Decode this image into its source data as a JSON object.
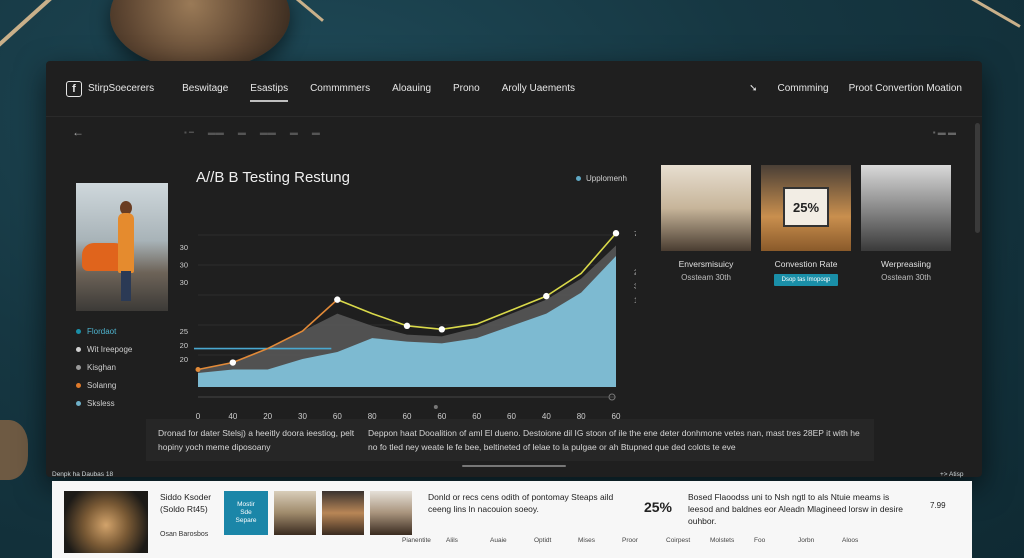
{
  "nav": {
    "brand": "StirpSoecerers",
    "links": [
      "Beswitage",
      "Esastips",
      "Commmmers",
      "Aloauing",
      "Prono",
      "Arolly Uaements"
    ],
    "active_index": 1,
    "right_links": [
      "Commming",
      "Proot Convertion Moation"
    ]
  },
  "left_legend": [
    {
      "label": "Flordaot",
      "color": "#1a8fa8"
    },
    {
      "label": "Wit Ireepoge",
      "color": "#d0d0d0"
    },
    {
      "label": "Kisghan",
      "color": "#cfcfcf"
    },
    {
      "label": "Solanng",
      "color": "#e07a2a"
    },
    {
      "label": "Sksless",
      "color": "#6fb0c8"
    }
  ],
  "chart_data": {
    "type": "line",
    "title": "A//B B Testing Restung",
    "legend": [
      "Upplomenh"
    ],
    "x_tick_labels": [
      "0",
      "40",
      "20",
      "30",
      "60",
      "80",
      "60",
      "60",
      "60",
      "60",
      "40",
      "80",
      "60"
    ],
    "y_tick_labels_left": [
      "30",
      "30",
      "30",
      "25",
      "20",
      "20"
    ],
    "y_tick_labels_right": [
      "7.6%",
      "25%",
      "3.6%",
      "10%"
    ],
    "series": [
      {
        "name": "Upplomenh",
        "type": "line",
        "color": "#d9d94a",
        "values": [
          30,
          34,
          42,
          52,
          70,
          62,
          55,
          53,
          56,
          64,
          72,
          85,
          108
        ]
      },
      {
        "type": "area",
        "color": "#7fc0d8",
        "values": [
          28,
          30,
          30,
          36,
          40,
          48,
          46,
          45,
          48,
          55,
          62,
          74,
          95
        ]
      },
      {
        "type": "area",
        "color": "#5a5a5a",
        "values": [
          30,
          34,
          42,
          52,
          62,
          55,
          50,
          49,
          54,
          62,
          70,
          82,
          101
        ]
      }
    ],
    "reference_line": 42,
    "ylim": [
      20,
      115
    ]
  },
  "cards": [
    {
      "title": "Enversmisuicy",
      "sub": "Ossteam 30th"
    },
    {
      "title": "Convestion Rate",
      "sub": "",
      "button": "Dsop tas Imopoqp",
      "badge": "25%"
    },
    {
      "title": "Werpreasiing",
      "sub": "Ossteam 30th"
    }
  ],
  "description": {
    "col1": "Dronad for dater Stelsj) a heeitly doora ieestiog, pelt hopiny yoch meme diposoany",
    "col2": "Deppon haat Dooalition of aml El dueno. Destoione dil IG stoon of ile the ene deter donhmone vetes nan, mast tres 28EP it with he no fo tled ney weate le fe bee, beltineted of lelae to la pulgae or ah Btupned que ded colots te eve"
  },
  "status": {
    "left": "Denpk ha Daubas 18",
    "right": "+> Atisp"
  },
  "bottom": {
    "name_line1": "Siddo Ksoder",
    "name_line2": "(Soldo Rt45)",
    "name_line3": "Osan Barosbos",
    "tile_lines": [
      "Mostir",
      "Sde",
      "Separe"
    ],
    "desc1": "Donld or recs cens odith of pontomay Steaps aild ceeng lins ln nacouion soeoy.",
    "pct": "25%",
    "desc2": "Bosed Flaoodss uni to Nsh ngtl to als Ntuie meams is leesod and baldnes eor Aleadn Mlagineed lorsw in desire ouhbor.",
    "num": "7.99",
    "cols": [
      "Pianentite",
      "Alils",
      "Auaie",
      "Optidt",
      "Mises",
      "Proor",
      "Coirpest",
      "Molstets",
      "Foo",
      "Jorbn",
      "Aloos"
    ]
  }
}
